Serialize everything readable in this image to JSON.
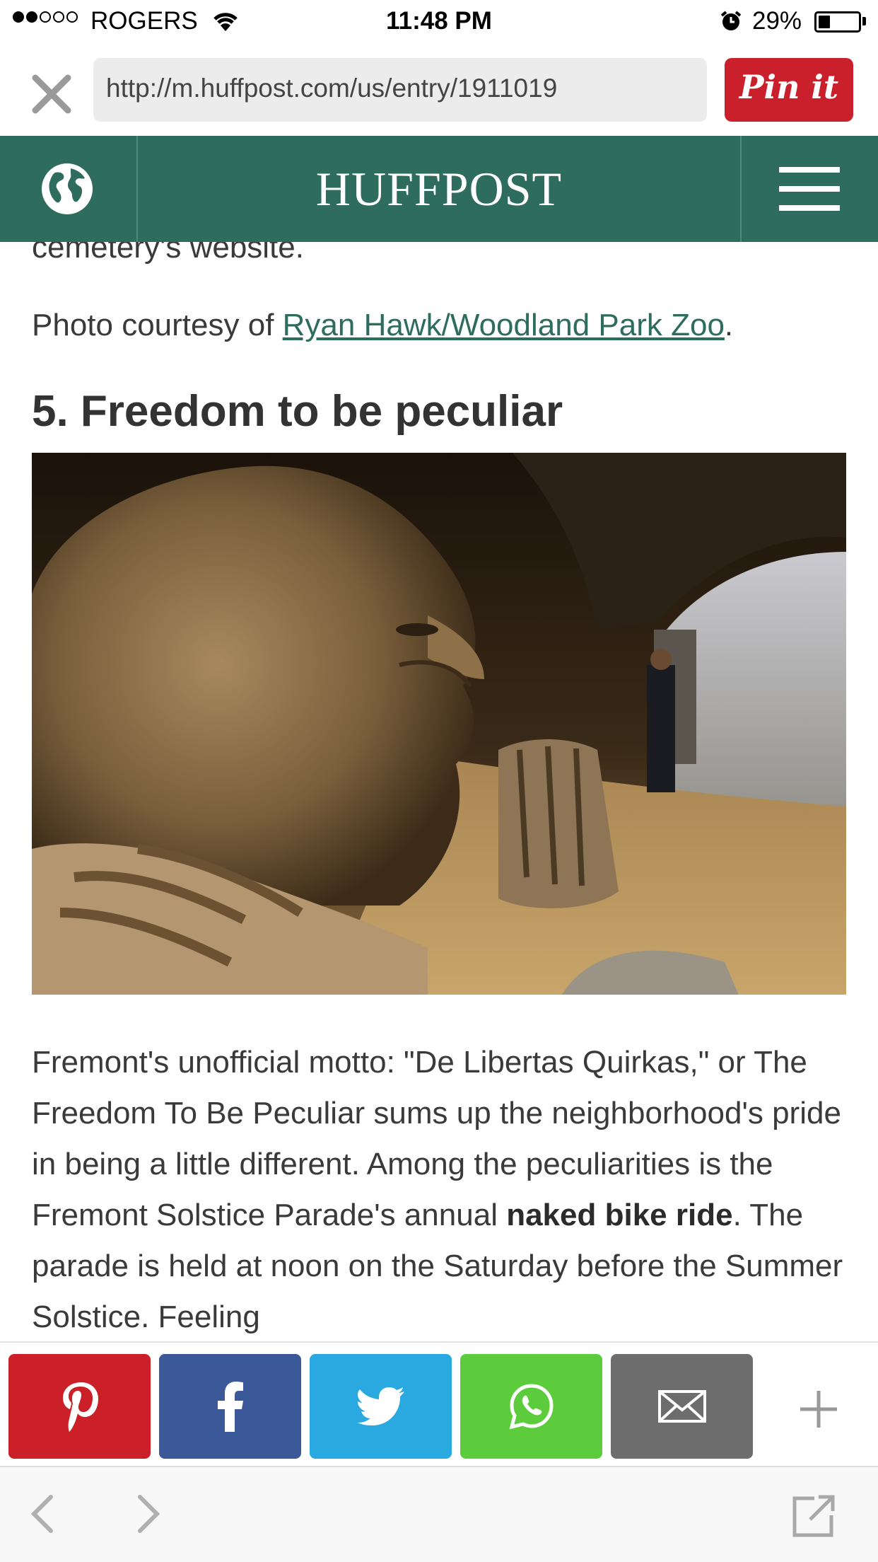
{
  "status_bar": {
    "carrier": "ROGERS",
    "time": "11:48 PM",
    "battery_percent": "29%",
    "battery_level": 0.29,
    "signal_bars": 2,
    "signal_total": 5
  },
  "browser": {
    "url": "http://m.huffpost.com/us/entry/1911019",
    "pin_label": "Pin it",
    "pin_color": "#c9202b"
  },
  "header": {
    "logo": "HUFFPOST",
    "background": "#2e6d5e"
  },
  "article": {
    "prev_text": "cemetery's website.",
    "credit_prefix": "Photo courtesy of ",
    "credit_link": "Ryan Hawk/Woodland Park Zoo",
    "credit_suffix": ".",
    "section_heading": "5. Freedom to be peculiar",
    "body_1": "Fremont's unofficial motto: \"De Libertas Quirkas,\" or The Freedom To Be Peculiar sums up the neighborhood's pride in being a little different.  Among the peculiarities is the Fremont Solstice Parade's annual ",
    "body_bold": "naked bike ride",
    "body_2": ". The parade is held at noon on the Saturday before the Summer Solstice.  Feeling"
  },
  "share_bar": {
    "buttons": [
      {
        "icon": "pinterest-icon",
        "color": "#cb2027"
      },
      {
        "icon": "facebook-icon",
        "color": "#3b5998"
      },
      {
        "icon": "twitter-icon",
        "color": "#2aa9e0"
      },
      {
        "icon": "whatsapp-icon",
        "color": "#5ccb3c"
      },
      {
        "icon": "email-icon",
        "color": "#6d6d6d"
      }
    ],
    "more_icon": "plus-icon"
  },
  "toolbar": {
    "icons": [
      "back-arrow-icon",
      "forward-arrow-icon",
      "open-external-icon"
    ]
  }
}
